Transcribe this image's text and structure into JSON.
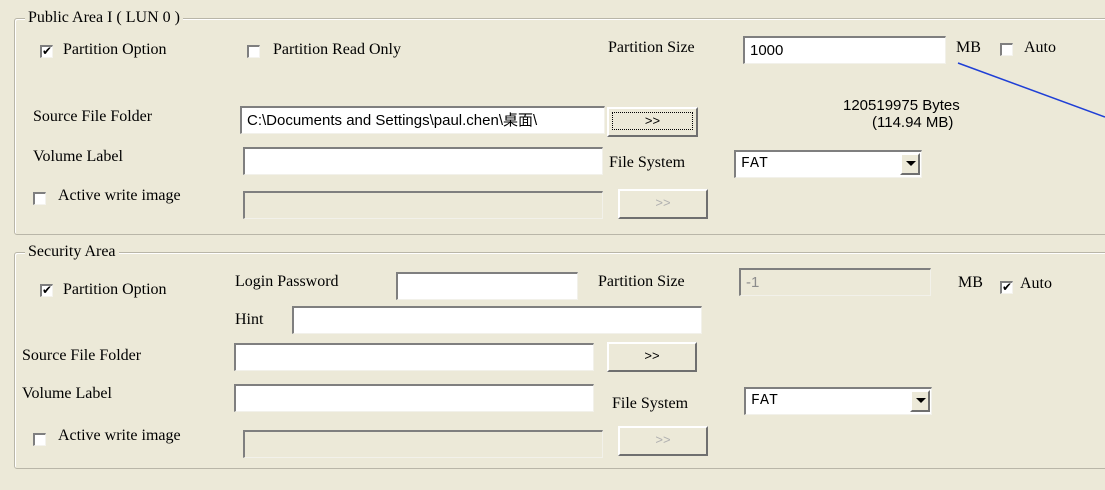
{
  "public_area": {
    "legend": "Public Area I ( LUN 0 )",
    "partition_option": {
      "label": "Partition Option",
      "checked": "✔"
    },
    "read_only": {
      "label": "Partition Read Only",
      "checked": ""
    },
    "partition_size_label": "Partition Size",
    "partition_size_value": "1000",
    "mb_label": "MB",
    "auto": {
      "label": "Auto",
      "checked": ""
    },
    "source_folder_label": "Source File Folder",
    "source_folder_value": "C:\\Documents and Settings\\paul.chen\\桌面\\",
    "browse_button": ">>",
    "bytes_line1": "120519975 Bytes",
    "bytes_line2": "(114.94 MB)",
    "volume_label": "Volume Label",
    "volume_value": "",
    "file_system_label": "File System",
    "file_system_value": "FAT",
    "active_write": {
      "label": "Active write image",
      "checked": ""
    },
    "image_path_value": "",
    "image_browse_button": ">>"
  },
  "security_area": {
    "legend": "Security Area",
    "partition_option": {
      "label": "Partition Option",
      "checked": "✔"
    },
    "login_password_label": "Login Password",
    "login_password_value": "",
    "partition_size_label": "Partition Size",
    "partition_size_value": "-1",
    "mb_label": "MB",
    "auto": {
      "label": "Auto",
      "checked": "✔"
    },
    "hint_label": "Hint",
    "hint_value": "",
    "source_folder_label": "Source File Folder",
    "source_folder_value": "",
    "browse_button": ">>",
    "volume_label": "Volume Label",
    "volume_value": "",
    "file_system_label": "File System",
    "file_system_value": "FAT",
    "active_write": {
      "label": "Active write image",
      "checked": ""
    },
    "image_path_value": "",
    "image_browse_button": ">>"
  },
  "colors": {
    "panel": "#ece9d8",
    "callout_line": "#1f3fd6"
  }
}
